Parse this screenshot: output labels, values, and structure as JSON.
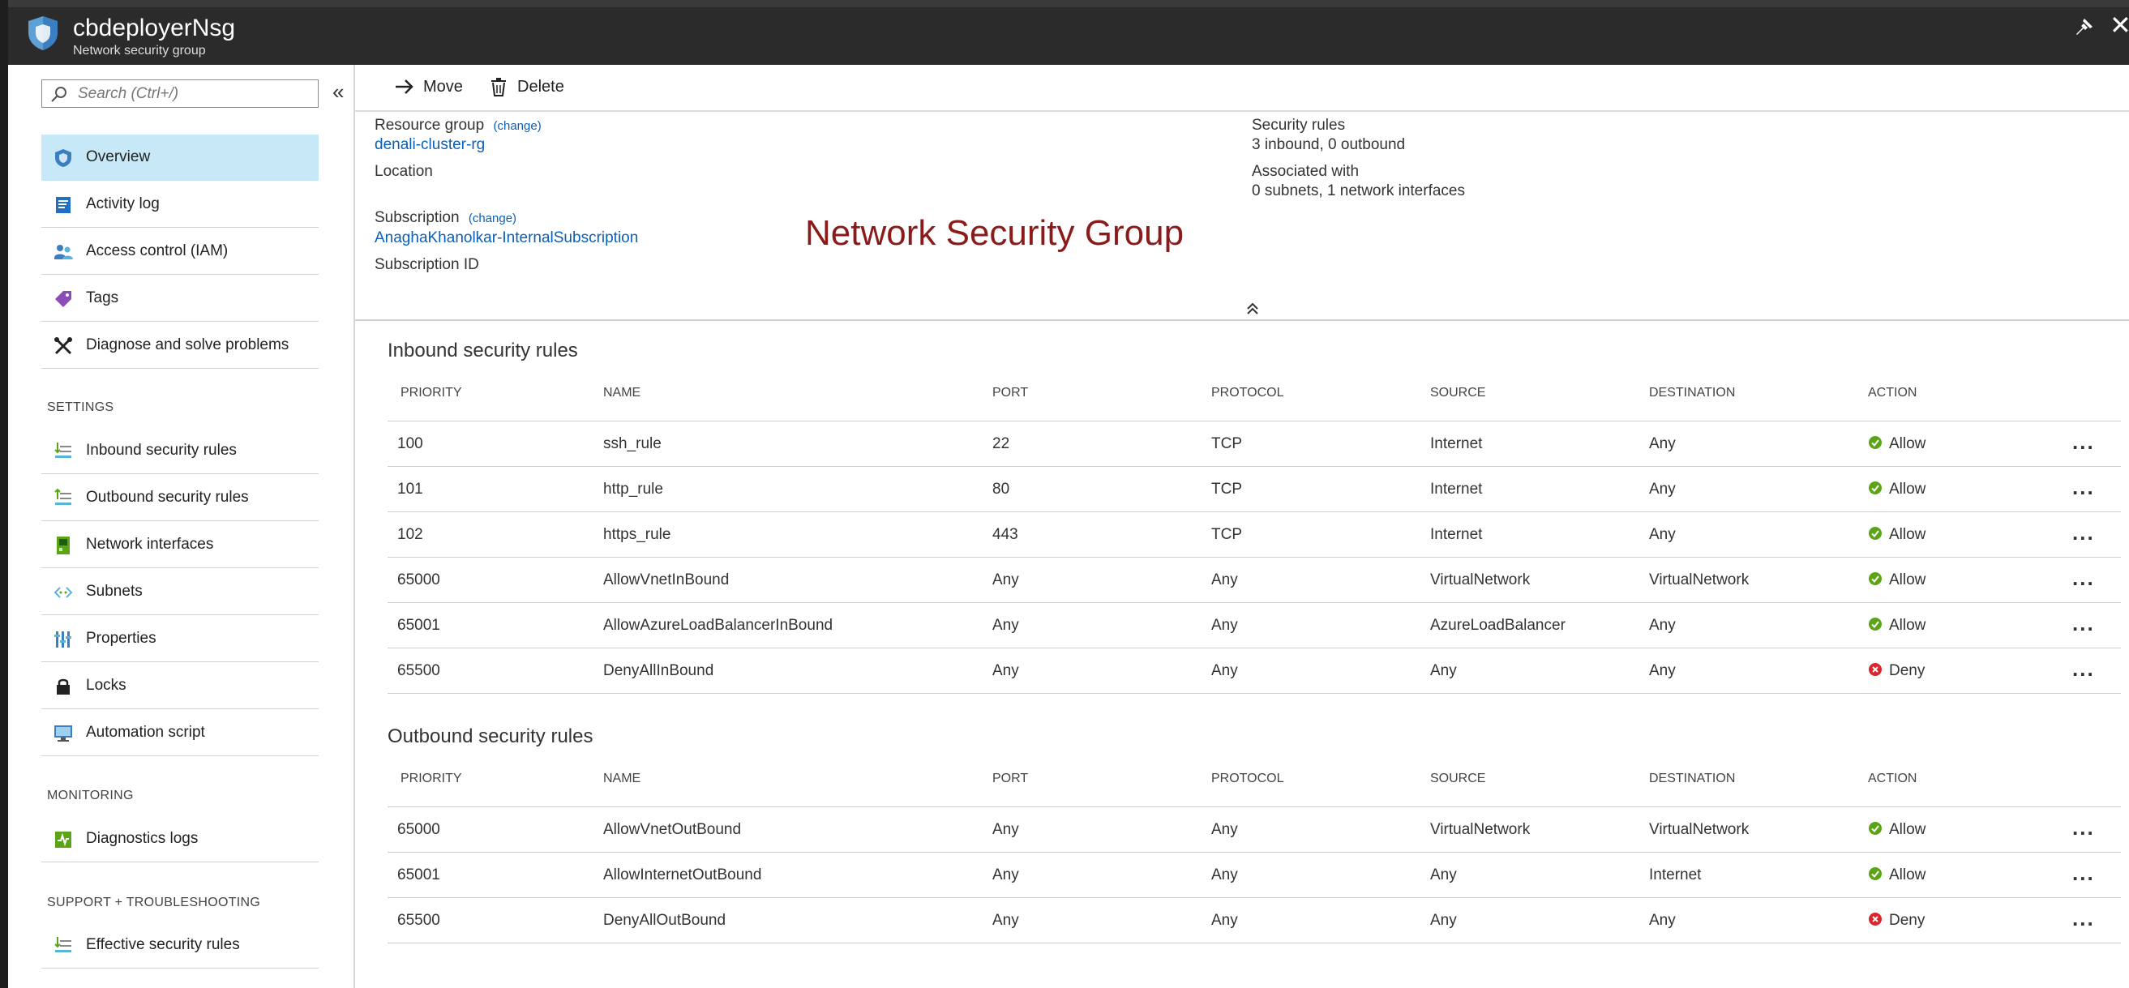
{
  "header": {
    "title": "cbdeployerNsg",
    "subtitle": "Network security group"
  },
  "sidebar": {
    "search_placeholder": "Search (Ctrl+/)",
    "collapse_glyph": "«",
    "items": [
      {
        "label": "Overview",
        "icon": "shield-icon"
      },
      {
        "label": "Activity log",
        "icon": "activity-log-icon"
      },
      {
        "label": "Access control (IAM)",
        "icon": "users-icon"
      },
      {
        "label": "Tags",
        "icon": "tag-icon"
      },
      {
        "label": "Diagnose and solve problems",
        "icon": "wrench-icon"
      }
    ],
    "settings_header": "SETTINGS",
    "settings_items": [
      {
        "label": "Inbound security rules",
        "icon": "inbound-rules-icon"
      },
      {
        "label": "Outbound security rules",
        "icon": "outbound-rules-icon"
      },
      {
        "label": "Network interfaces",
        "icon": "network-interface-icon"
      },
      {
        "label": "Subnets",
        "icon": "subnet-icon"
      },
      {
        "label": "Properties",
        "icon": "properties-icon"
      },
      {
        "label": "Locks",
        "icon": "lock-icon"
      },
      {
        "label": "Automation script",
        "icon": "automation-script-icon"
      }
    ],
    "monitoring_header": "MONITORING",
    "monitoring_items": [
      {
        "label": "Diagnostics logs",
        "icon": "diagnostics-icon"
      }
    ],
    "support_header": "SUPPORT + TROUBLESHOOTING",
    "support_items": [
      {
        "label": "Effective security rules",
        "icon": "effective-rules-icon"
      }
    ]
  },
  "toolbar": {
    "move_label": "Move",
    "delete_label": "Delete"
  },
  "essentials": {
    "resource_group_label": "Resource group",
    "change_label": "(change)",
    "resource_group_value": "denali-cluster-rg",
    "location_label": "Location",
    "subscription_label": "Subscription",
    "subscription_value": "AnaghaKhanolkar-InternalSubscription",
    "subscription_id_label": "Subscription ID",
    "security_rules_label": "Security rules",
    "security_rules_value": "3 inbound, 0 outbound",
    "associated_label": "Associated with",
    "associated_value": "0 subnets, 1 network interfaces"
  },
  "overlay_caption": "Network Security Group",
  "columns": {
    "priority": "PRIORITY",
    "name": "NAME",
    "port": "PORT",
    "protocol": "PROTOCOL",
    "source": "SOURCE",
    "destination": "DESTINATION",
    "action": "ACTION"
  },
  "more_glyph": "...",
  "colors": {
    "allow": "#5ba317",
    "deny": "#d9262a",
    "accent_link": "#0b5fb5",
    "active_nav": "#c7e9f7",
    "caption": "#8b1a1a"
  },
  "inbound": {
    "title": "Inbound security rules",
    "rows": [
      {
        "priority": "100",
        "name": "ssh_rule",
        "port": "22",
        "protocol": "TCP",
        "source": "Internet",
        "destination": "Any",
        "action": "Allow",
        "status": "allow"
      },
      {
        "priority": "101",
        "name": "http_rule",
        "port": "80",
        "protocol": "TCP",
        "source": "Internet",
        "destination": "Any",
        "action": "Allow",
        "status": "allow"
      },
      {
        "priority": "102",
        "name": "https_rule",
        "port": "443",
        "protocol": "TCP",
        "source": "Internet",
        "destination": "Any",
        "action": "Allow",
        "status": "allow"
      },
      {
        "priority": "65000",
        "name": "AllowVnetInBound",
        "port": "Any",
        "protocol": "Any",
        "source": "VirtualNetwork",
        "destination": "VirtualNetwork",
        "action": "Allow",
        "status": "allow"
      },
      {
        "priority": "65001",
        "name": "AllowAzureLoadBalancerInBound",
        "port": "Any",
        "protocol": "Any",
        "source": "AzureLoadBalancer",
        "destination": "Any",
        "action": "Allow",
        "status": "allow"
      },
      {
        "priority": "65500",
        "name": "DenyAllInBound",
        "port": "Any",
        "protocol": "Any",
        "source": "Any",
        "destination": "Any",
        "action": "Deny",
        "status": "deny"
      }
    ]
  },
  "outbound": {
    "title": "Outbound security rules",
    "rows": [
      {
        "priority": "65000",
        "name": "AllowVnetOutBound",
        "port": "Any",
        "protocol": "Any",
        "source": "VirtualNetwork",
        "destination": "VirtualNetwork",
        "action": "Allow",
        "status": "allow"
      },
      {
        "priority": "65001",
        "name": "AllowInternetOutBound",
        "port": "Any",
        "protocol": "Any",
        "source": "Any",
        "destination": "Internet",
        "action": "Allow",
        "status": "allow"
      },
      {
        "priority": "65500",
        "name": "DenyAllOutBound",
        "port": "Any",
        "protocol": "Any",
        "source": "Any",
        "destination": "Any",
        "action": "Deny",
        "status": "deny"
      }
    ]
  }
}
